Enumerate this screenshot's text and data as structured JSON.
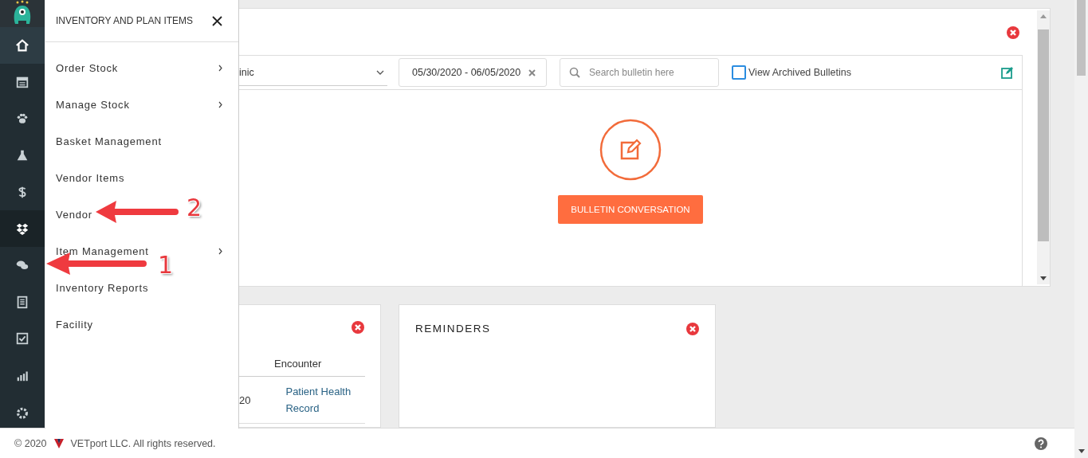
{
  "sidebar": {
    "items": [
      {
        "kind": "home",
        "selected": false,
        "highlighted": true
      },
      {
        "kind": "calendar",
        "selected": false,
        "highlighted": false
      },
      {
        "kind": "paw",
        "selected": false,
        "highlighted": false
      },
      {
        "kind": "flask",
        "selected": false,
        "highlighted": false
      },
      {
        "kind": "dollar",
        "selected": false,
        "highlighted": false
      },
      {
        "kind": "boxes",
        "selected": true,
        "highlighted": false
      },
      {
        "kind": "chat",
        "selected": false,
        "highlighted": false
      },
      {
        "kind": "list",
        "selected": false,
        "highlighted": false
      },
      {
        "kind": "check",
        "selected": false,
        "highlighted": false
      },
      {
        "kind": "chart",
        "selected": false,
        "highlighted": false
      },
      {
        "kind": "gear",
        "selected": false,
        "highlighted": false
      }
    ]
  },
  "flyout": {
    "title": "INVENTORY AND PLAN ITEMS",
    "items": [
      {
        "label": "Order Stock",
        "submenu": true
      },
      {
        "label": "Manage Stock",
        "submenu": true
      },
      {
        "label": "Basket Management",
        "submenu": false
      },
      {
        "label": "Vendor Items",
        "submenu": false
      },
      {
        "label": "Vendor",
        "submenu": false
      },
      {
        "label": "Item Management",
        "submenu": true
      },
      {
        "label": "Inventory Reports",
        "submenu": false
      },
      {
        "label": "Facility",
        "submenu": false
      }
    ]
  },
  "bulletin": {
    "clinic": "inic",
    "date_range": "05/30/2020 - 06/05/2020",
    "search": {
      "placeholder": "Search bulletin here"
    },
    "archived": {
      "label": "View Archived Bulletins",
      "checked": false
    },
    "button": "BULLETIN CONVERSATION"
  },
  "encounters": {
    "columns": [
      "Encounter"
    ],
    "rows": [
      {
        "date": "20",
        "encounter": "Patient Health Record"
      }
    ]
  },
  "reminders": {
    "title": "REMINDERS"
  },
  "footer": {
    "copyright": "© 2020",
    "company": "VETport LLC. All rights reserved."
  },
  "annotations": [
    {
      "number": "2"
    },
    {
      "number": "1"
    }
  ]
}
